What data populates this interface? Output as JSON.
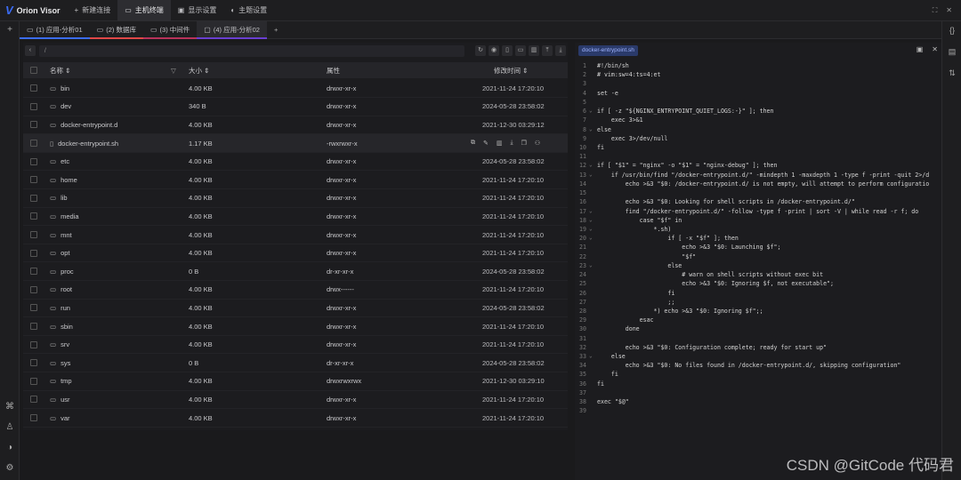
{
  "app": {
    "name": "Orion Visor"
  },
  "topnav": [
    {
      "icon": "+",
      "label": "新建连接"
    },
    {
      "icon": "▭",
      "label": "主机终端",
      "active": true
    },
    {
      "icon": "▣",
      "label": "显示设置"
    },
    {
      "icon": "◐",
      "label": "主题设置"
    }
  ],
  "tabs": [
    {
      "label": "(1) 应用-分析01"
    },
    {
      "label": "(2) 数据库"
    },
    {
      "label": "(3) 中间件"
    },
    {
      "label": "(4) 应用-分析02",
      "active": true
    }
  ],
  "path": {
    "value": "/"
  },
  "columns": {
    "name": "名称",
    "size": "大小",
    "perm": "属性",
    "time": "修改时间"
  },
  "files": [
    {
      "name": "bin",
      "type": "dir",
      "size": "4.00 KB",
      "perm": "drwxr-xr-x",
      "time": "2021-11-24 17:20:10"
    },
    {
      "name": "dev",
      "type": "dir",
      "size": "340 B",
      "perm": "drwxr-xr-x",
      "time": "2024-05-28 23:58:02"
    },
    {
      "name": "docker-entrypoint.d",
      "type": "dir",
      "size": "4.00 KB",
      "perm": "drwxr-xr-x",
      "time": "2021-12-30 03:29:12"
    },
    {
      "name": "docker-entrypoint.sh",
      "type": "file",
      "size": "1.17 KB",
      "perm": "-rwxrwxr-x",
      "time": ""
    },
    {
      "name": "etc",
      "type": "dir",
      "size": "4.00 KB",
      "perm": "drwxr-xr-x",
      "time": "2024-05-28 23:58:02"
    },
    {
      "name": "home",
      "type": "dir",
      "size": "4.00 KB",
      "perm": "drwxr-xr-x",
      "time": "2021-11-24 17:20:10"
    },
    {
      "name": "lib",
      "type": "dir",
      "size": "4.00 KB",
      "perm": "drwxr-xr-x",
      "time": "2021-11-24 17:20:10"
    },
    {
      "name": "media",
      "type": "dir",
      "size": "4.00 KB",
      "perm": "drwxr-xr-x",
      "time": "2021-11-24 17:20:10"
    },
    {
      "name": "mnt",
      "type": "dir",
      "size": "4.00 KB",
      "perm": "drwxr-xr-x",
      "time": "2021-11-24 17:20:10"
    },
    {
      "name": "opt",
      "type": "dir",
      "size": "4.00 KB",
      "perm": "drwxr-xr-x",
      "time": "2021-11-24 17:20:10"
    },
    {
      "name": "proc",
      "type": "dir",
      "size": "0 B",
      "perm": "dr-xr-xr-x",
      "time": "2024-05-28 23:58:02"
    },
    {
      "name": "root",
      "type": "dir",
      "size": "4.00 KB",
      "perm": "drwx------",
      "time": "2021-11-24 17:20:10"
    },
    {
      "name": "run",
      "type": "dir",
      "size": "4.00 KB",
      "perm": "drwxr-xr-x",
      "time": "2024-05-28 23:58:02"
    },
    {
      "name": "sbin",
      "type": "dir",
      "size": "4.00 KB",
      "perm": "drwxr-xr-x",
      "time": "2021-11-24 17:20:10"
    },
    {
      "name": "srv",
      "type": "dir",
      "size": "4.00 KB",
      "perm": "drwxr-xr-x",
      "time": "2021-11-24 17:20:10"
    },
    {
      "name": "sys",
      "type": "dir",
      "size": "0 B",
      "perm": "dr-xr-xr-x",
      "time": "2024-05-28 23:58:02"
    },
    {
      "name": "tmp",
      "type": "dir",
      "size": "4.00 KB",
      "perm": "drwxrwxrwx",
      "time": "2021-12-30 03:29:10"
    },
    {
      "name": "usr",
      "type": "dir",
      "size": "4.00 KB",
      "perm": "drwxr-xr-x",
      "time": "2021-11-24 17:20:10"
    },
    {
      "name": "var",
      "type": "dir",
      "size": "4.00 KB",
      "perm": "drwxr-xr-x",
      "time": "2021-11-24 17:20:10"
    }
  ],
  "editor": {
    "filename": "docker-entrypoint.sh",
    "lines": [
      {
        "n": "1",
        "fold": "",
        "text": "#!/bin/sh"
      },
      {
        "n": "2",
        "fold": "",
        "text": "# vim:sw=4:ts=4:et"
      },
      {
        "n": "3",
        "fold": "",
        "text": ""
      },
      {
        "n": "4",
        "fold": "",
        "text": "set -e"
      },
      {
        "n": "5",
        "fold": "",
        "text": ""
      },
      {
        "n": "6",
        "fold": "⌄",
        "text": "if [ -z \"${NGINX_ENTRYPOINT_QUIET_LOGS:-}\" ]; then"
      },
      {
        "n": "7",
        "fold": "",
        "text": "    exec 3>&1"
      },
      {
        "n": "8",
        "fold": "⌄",
        "text": "else"
      },
      {
        "n": "9",
        "fold": "",
        "text": "    exec 3>/dev/null"
      },
      {
        "n": "10",
        "fold": "",
        "text": "fi"
      },
      {
        "n": "11",
        "fold": "",
        "text": ""
      },
      {
        "n": "12",
        "fold": "⌄",
        "text": "if [ \"$1\" = \"nginx\" -o \"$1\" = \"nginx-debug\" ]; then"
      },
      {
        "n": "13",
        "fold": "⌄",
        "text": "    if /usr/bin/find \"/docker-entrypoint.d/\" -mindepth 1 -maxdepth 1 -type f -print -quit 2>/d"
      },
      {
        "n": "14",
        "fold": "",
        "text": "        echo >&3 \"$0: /docker-entrypoint.d/ is not empty, will attempt to perform configuratio"
      },
      {
        "n": "15",
        "fold": "",
        "text": ""
      },
      {
        "n": "16",
        "fold": "",
        "text": "        echo >&3 \"$0: Looking for shell scripts in /docker-entrypoint.d/\""
      },
      {
        "n": "17",
        "fold": "⌄",
        "text": "        find \"/docker-entrypoint.d/\" -follow -type f -print | sort -V | while read -r f; do"
      },
      {
        "n": "18",
        "fold": "⌄",
        "text": "            case \"$f\" in"
      },
      {
        "n": "19",
        "fold": "⌄",
        "text": "                *.sh)"
      },
      {
        "n": "20",
        "fold": "⌄",
        "text": "                    if [ -x \"$f\" ]; then"
      },
      {
        "n": "21",
        "fold": "",
        "text": "                        echo >&3 \"$0: Launching $f\";"
      },
      {
        "n": "22",
        "fold": "",
        "text": "                        \"$f\""
      },
      {
        "n": "23",
        "fold": "⌄",
        "text": "                    else"
      },
      {
        "n": "24",
        "fold": "",
        "text": "                        # warn on shell scripts without exec bit"
      },
      {
        "n": "25",
        "fold": "",
        "text": "                        echo >&3 \"$0: Ignoring $f, not executable\";"
      },
      {
        "n": "26",
        "fold": "",
        "text": "                    fi"
      },
      {
        "n": "27",
        "fold": "",
        "text": "                    ;;"
      },
      {
        "n": "28",
        "fold": "",
        "text": "                *) echo >&3 \"$0: Ignoring $f\";;"
      },
      {
        "n": "29",
        "fold": "",
        "text": "            esac"
      },
      {
        "n": "30",
        "fold": "",
        "text": "        done"
      },
      {
        "n": "31",
        "fold": "",
        "text": ""
      },
      {
        "n": "32",
        "fold": "",
        "text": "        echo >&3 \"$0: Configuration complete; ready for start up\""
      },
      {
        "n": "33",
        "fold": "⌄",
        "text": "    else"
      },
      {
        "n": "34",
        "fold": "",
        "text": "        echo >&3 \"$0: No files found in /docker-entrypoint.d/, skipping configuration\""
      },
      {
        "n": "35",
        "fold": "",
        "text": "    fi"
      },
      {
        "n": "36",
        "fold": "",
        "text": "fi"
      },
      {
        "n": "37",
        "fold": "",
        "text": ""
      },
      {
        "n": "38",
        "fold": "",
        "text": "exec \"$@\""
      },
      {
        "n": "39",
        "fold": "",
        "text": ""
      }
    ]
  },
  "watermark": "CSDN @GitCode 代码君"
}
